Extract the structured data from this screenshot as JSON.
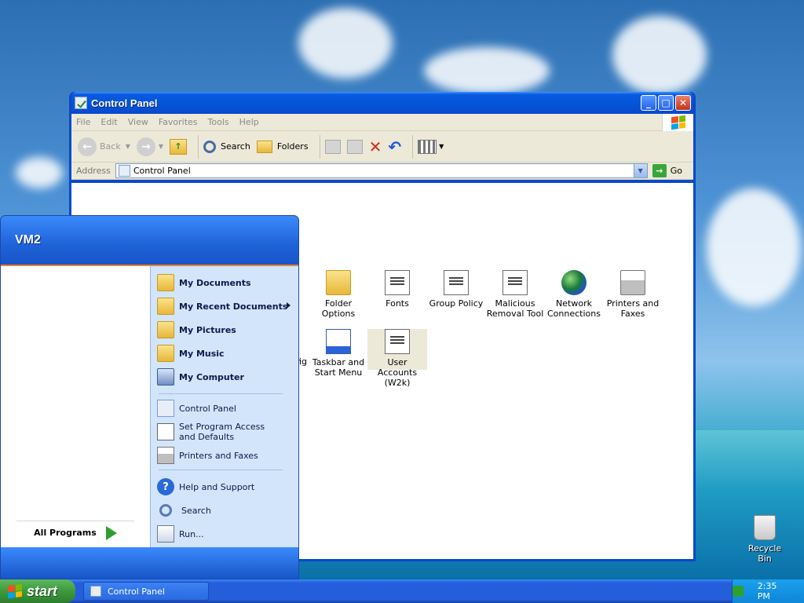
{
  "window": {
    "title": "Control Panel",
    "menu": [
      "File",
      "Edit",
      "View",
      "Favorites",
      "Tools",
      "Help"
    ],
    "toolbar": {
      "back": "Back",
      "search": "Search",
      "folders": "Folders"
    },
    "address": {
      "label": "Address",
      "value": "Control Panel",
      "go": "Go"
    },
    "items": [
      {
        "label": "Folder Options",
        "icon": "folder-options-icon"
      },
      {
        "label": "Fonts",
        "icon": "fonts-icon"
      },
      {
        "label": "Group Policy",
        "icon": "group-policy-icon"
      },
      {
        "label": "Malicious Removal Tool",
        "icon": "malicious-removal-tool-icon"
      },
      {
        "label": "Network Connections",
        "icon": "network-connections-icon"
      },
      {
        "label": "Printers and Faxes",
        "icon": "printers-faxes-icon"
      },
      {
        "label": "fig",
        "icon": ""
      },
      {
        "label": "Taskbar and Start Menu",
        "icon": "taskbar-start-menu-icon"
      },
      {
        "label": "User Accounts (W2k)",
        "icon": "user-accounts-icon"
      }
    ]
  },
  "start_menu": {
    "user": "VM2",
    "places": [
      "My Documents",
      "My Recent Documents",
      "My Pictures",
      "My Music",
      "My Computer"
    ],
    "settings": [
      "Control Panel",
      "Set Program Access and Defaults",
      "Printers and Faxes"
    ],
    "tools": [
      "Help and Support",
      "Search",
      "Run..."
    ],
    "all_programs": "All Programs"
  },
  "taskbar": {
    "start": "start",
    "task": "Control Panel",
    "clock": "2:35 PM"
  },
  "desktop": {
    "recycle_bin": "Recycle Bin"
  },
  "colors": {
    "xp_blue": "#245edb",
    "start_green": "#3c9a3c"
  }
}
